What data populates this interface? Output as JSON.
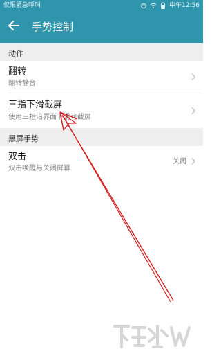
{
  "status_bar": {
    "left_text": "仅限紧急呼叫",
    "time": "中午12:56",
    "icons": [
      "alarm-icon",
      "wifi-icon",
      "battery-icon"
    ]
  },
  "app_bar": {
    "title": "手势控制",
    "back_icon": "arrow-left-icon"
  },
  "sections": [
    {
      "header": "动作",
      "items": [
        {
          "title": "翻转",
          "subtitle": "翻转静音"
        },
        {
          "title": "三指下滑截屏",
          "subtitle": "使用三指沿界面下滑可截屏"
        }
      ]
    },
    {
      "header": "黑屏手势",
      "items": [
        {
          "title": "双击",
          "subtitle": "双击唤醒与关闭屏幕",
          "value": "关闭"
        }
      ]
    }
  ],
  "colors": {
    "header_bg": "#2e95ad",
    "section_bg": "#eeeeee",
    "annotation_arrow": "#d42020"
  },
  "watermark_icon": "watermark-logo-icon"
}
